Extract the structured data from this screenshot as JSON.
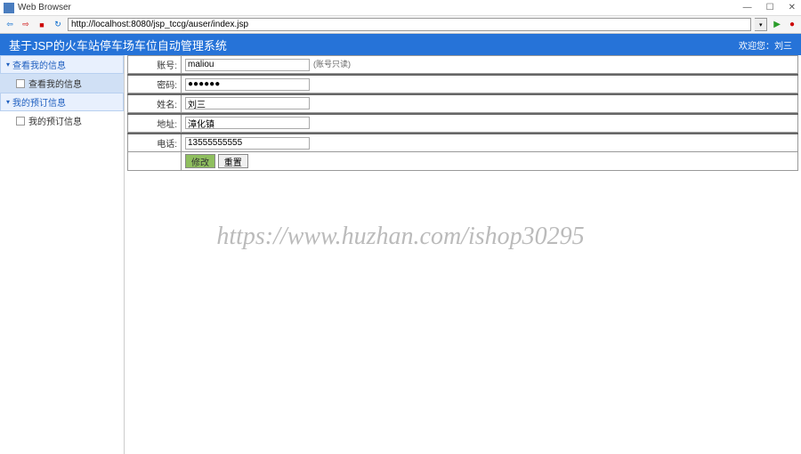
{
  "window": {
    "title": "Web Browser",
    "min": "—",
    "max": "☐",
    "close": "✕"
  },
  "toolbar": {
    "url": "http://localhost:8080/jsp_tccg/auser/index.jsp"
  },
  "header": {
    "title": "基于JSP的火车站停车场车位自动管理系统",
    "welcome": "欢迎您：刘三"
  },
  "sidebar": {
    "sections": [
      {
        "title": "查看我的信息",
        "items": [
          {
            "label": "查看我的信息",
            "active": true
          }
        ]
      },
      {
        "title": "我的预订信息",
        "items": [
          {
            "label": "我的预订信息",
            "active": false
          }
        ]
      }
    ]
  },
  "form": {
    "rows": [
      {
        "label": "账号:",
        "value": "maliou",
        "hint": "(账号只读)"
      },
      {
        "label": "密码:",
        "value": "●●●●●●",
        "hint": ""
      },
      {
        "label": "姓名:",
        "value": "刘三",
        "hint": ""
      },
      {
        "label": "地址:",
        "value": "漳化镇",
        "hint": ""
      },
      {
        "label": "电话:",
        "value": "13555555555",
        "hint": ""
      }
    ],
    "buttons": {
      "submit": "修改",
      "reset": "重置"
    }
  },
  "watermark": "https://www.huzhan.com/ishop30295"
}
